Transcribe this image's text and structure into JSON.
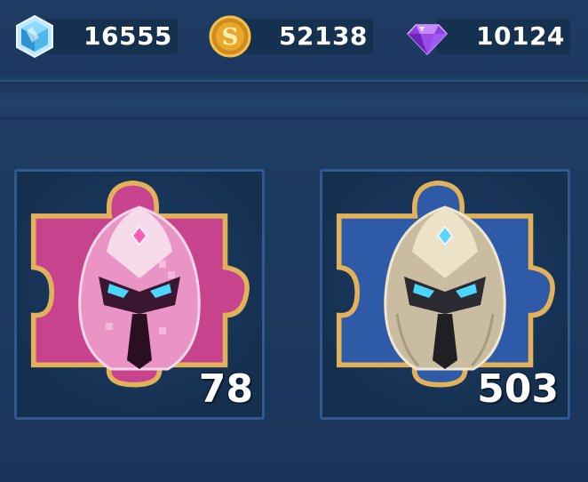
{
  "currencies": [
    {
      "icon": "crystal-icon",
      "value": "16555"
    },
    {
      "icon": "gold-coin-icon",
      "value": "52138"
    },
    {
      "icon": "purple-gem-icon",
      "value": "10124"
    }
  ],
  "items": [
    {
      "icon": "pink-helmet-puzzle-icon",
      "count": "78"
    },
    {
      "icon": "silver-helmet-puzzle-icon",
      "count": "503"
    }
  ]
}
